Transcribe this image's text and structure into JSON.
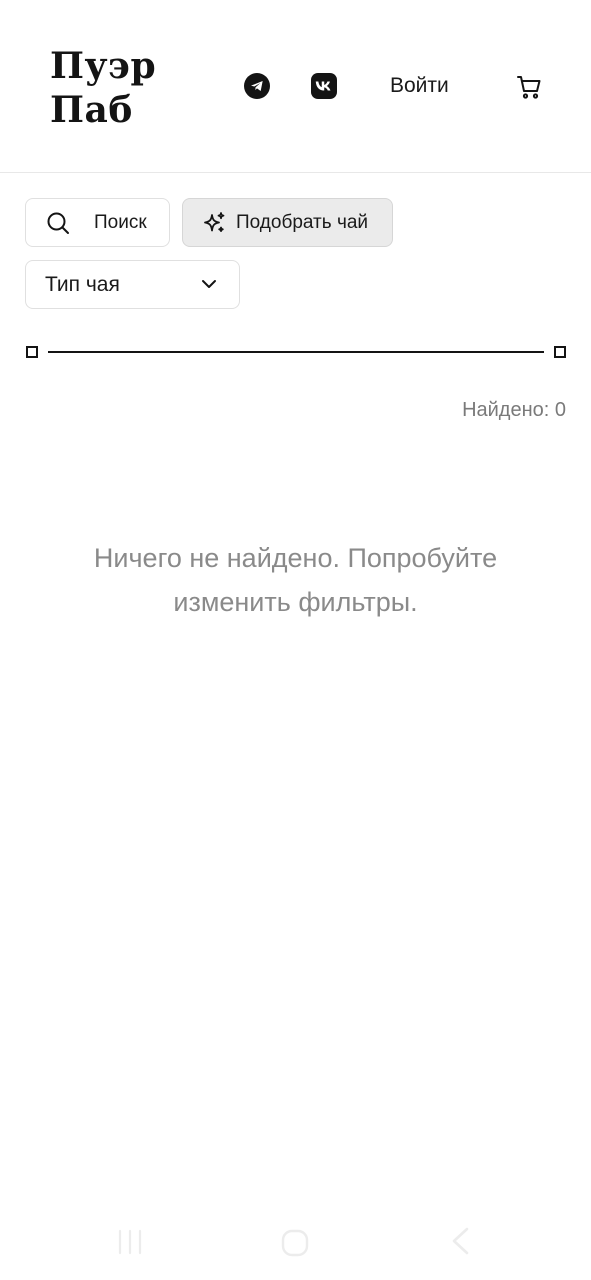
{
  "header": {
    "logo_line1": "Пуэр",
    "logo_line2": "Паб",
    "social": [
      "telegram-icon",
      "vk-icon"
    ],
    "login_label": "Войти",
    "cart_icon": "cart-icon"
  },
  "filters": {
    "search_label": "Поиск",
    "pick_tea_label": "Подобрать чай",
    "tea_type_label": "Тип чая"
  },
  "results": {
    "found_label": "Найдено: 0",
    "empty_line1": "Ничего не найдено. Попробуйте",
    "empty_line2": "изменить фильтры."
  },
  "colors": {
    "text": "#141414",
    "muted": "#8a8a8a",
    "pick_button_bg": "#ebebeb"
  },
  "system_nav": [
    "recent-apps-icon",
    "home-icon",
    "back-icon"
  ]
}
